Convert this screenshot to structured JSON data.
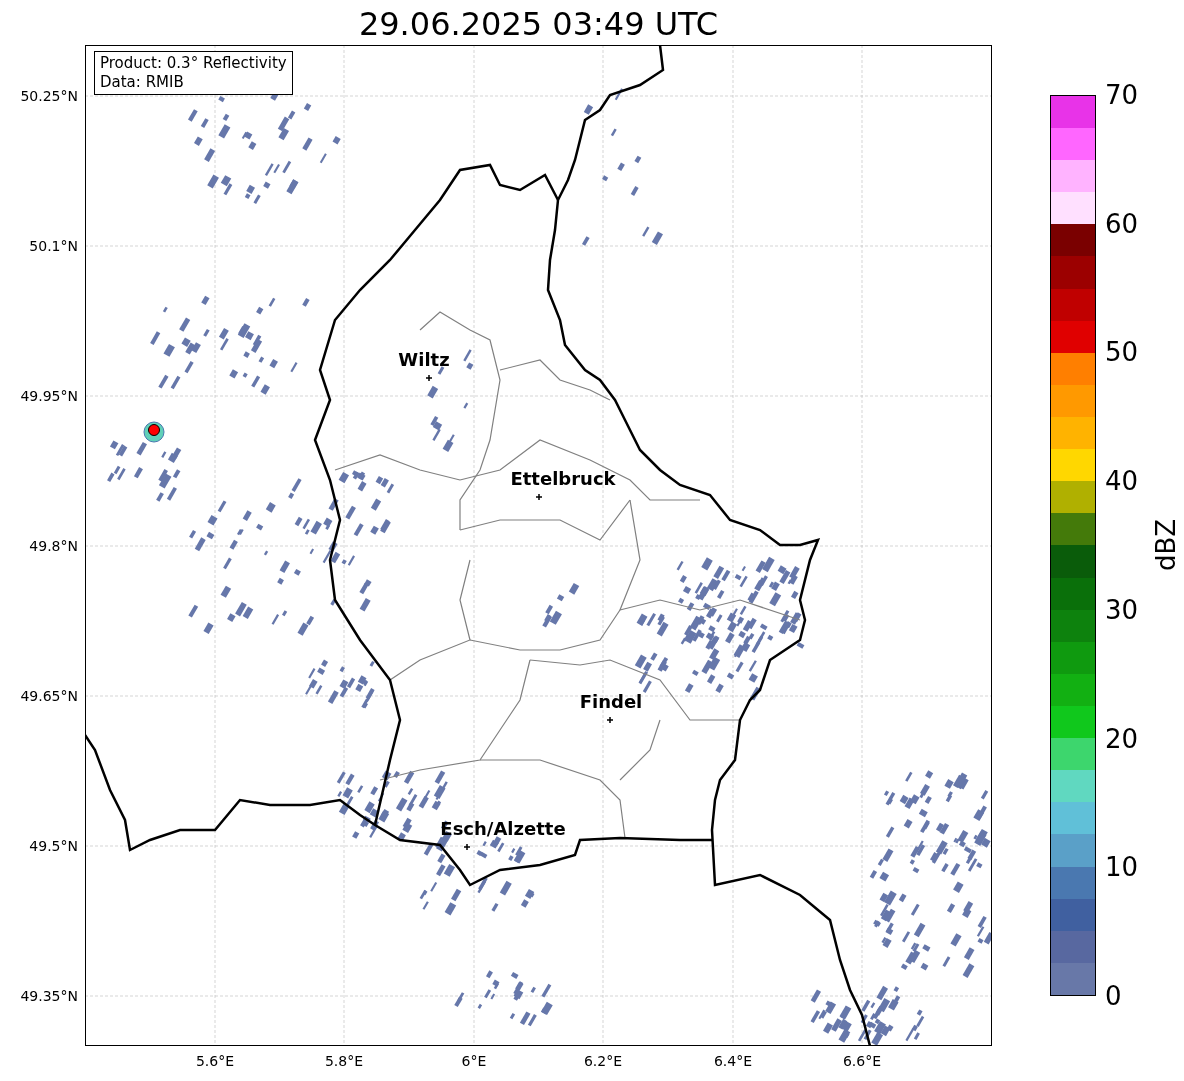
{
  "title": "29.06.2025 03:49 UTC",
  "legend": [
    "Product: 0.3° Reflectivity",
    "Data: RMIB"
  ],
  "map": {
    "x_ticks": [
      "5.6°E",
      "5.8°E",
      "6°E",
      "6.2°E",
      "6.4°E",
      "6.6°E"
    ],
    "y_ticks": [
      "50.25°N",
      "50.1°N",
      "49.95°N",
      "49.8°N",
      "49.65°N",
      "49.5°N",
      "49.35°N"
    ],
    "cities": [
      {
        "name": "Wiltz"
      },
      {
        "name": "Ettelbruck"
      },
      {
        "name": "Findel"
      },
      {
        "name": "Esch/Alzette"
      }
    ]
  },
  "colorbar": {
    "label": "dBZ",
    "ticks": [
      "70",
      "60",
      "50",
      "40",
      "30",
      "20",
      "10",
      "0"
    ],
    "segments": [
      {
        "color": "#6878a8"
      },
      {
        "color": "#5868a0"
      },
      {
        "color": "#4060a0"
      },
      {
        "color": "#4a78b0"
      },
      {
        "color": "#5aa0c8"
      },
      {
        "color": "#60c0d8"
      },
      {
        "color": "#60d8c0"
      },
      {
        "color": "#3dd66d"
      },
      {
        "color": "#10c81c"
      },
      {
        "color": "#12b012"
      },
      {
        "color": "#0f9a0f"
      },
      {
        "color": "#0d820d"
      },
      {
        "color": "#0a700a"
      },
      {
        "color": "#0a5c0a"
      },
      {
        "color": "#447a0a"
      },
      {
        "color": "#b0b000"
      },
      {
        "color": "#ffd700"
      },
      {
        "color": "#ffb300"
      },
      {
        "color": "#ff9900"
      },
      {
        "color": "#ff7f00"
      },
      {
        "color": "#e00000"
      },
      {
        "color": "#c00000"
      },
      {
        "color": "#9c0000"
      },
      {
        "color": "#7a0000"
      },
      {
        "color": "#ffe0ff"
      },
      {
        "color": "#ffb3ff"
      },
      {
        "color": "#ff66ff"
      },
      {
        "color": "#e833e8"
      }
    ]
  }
}
